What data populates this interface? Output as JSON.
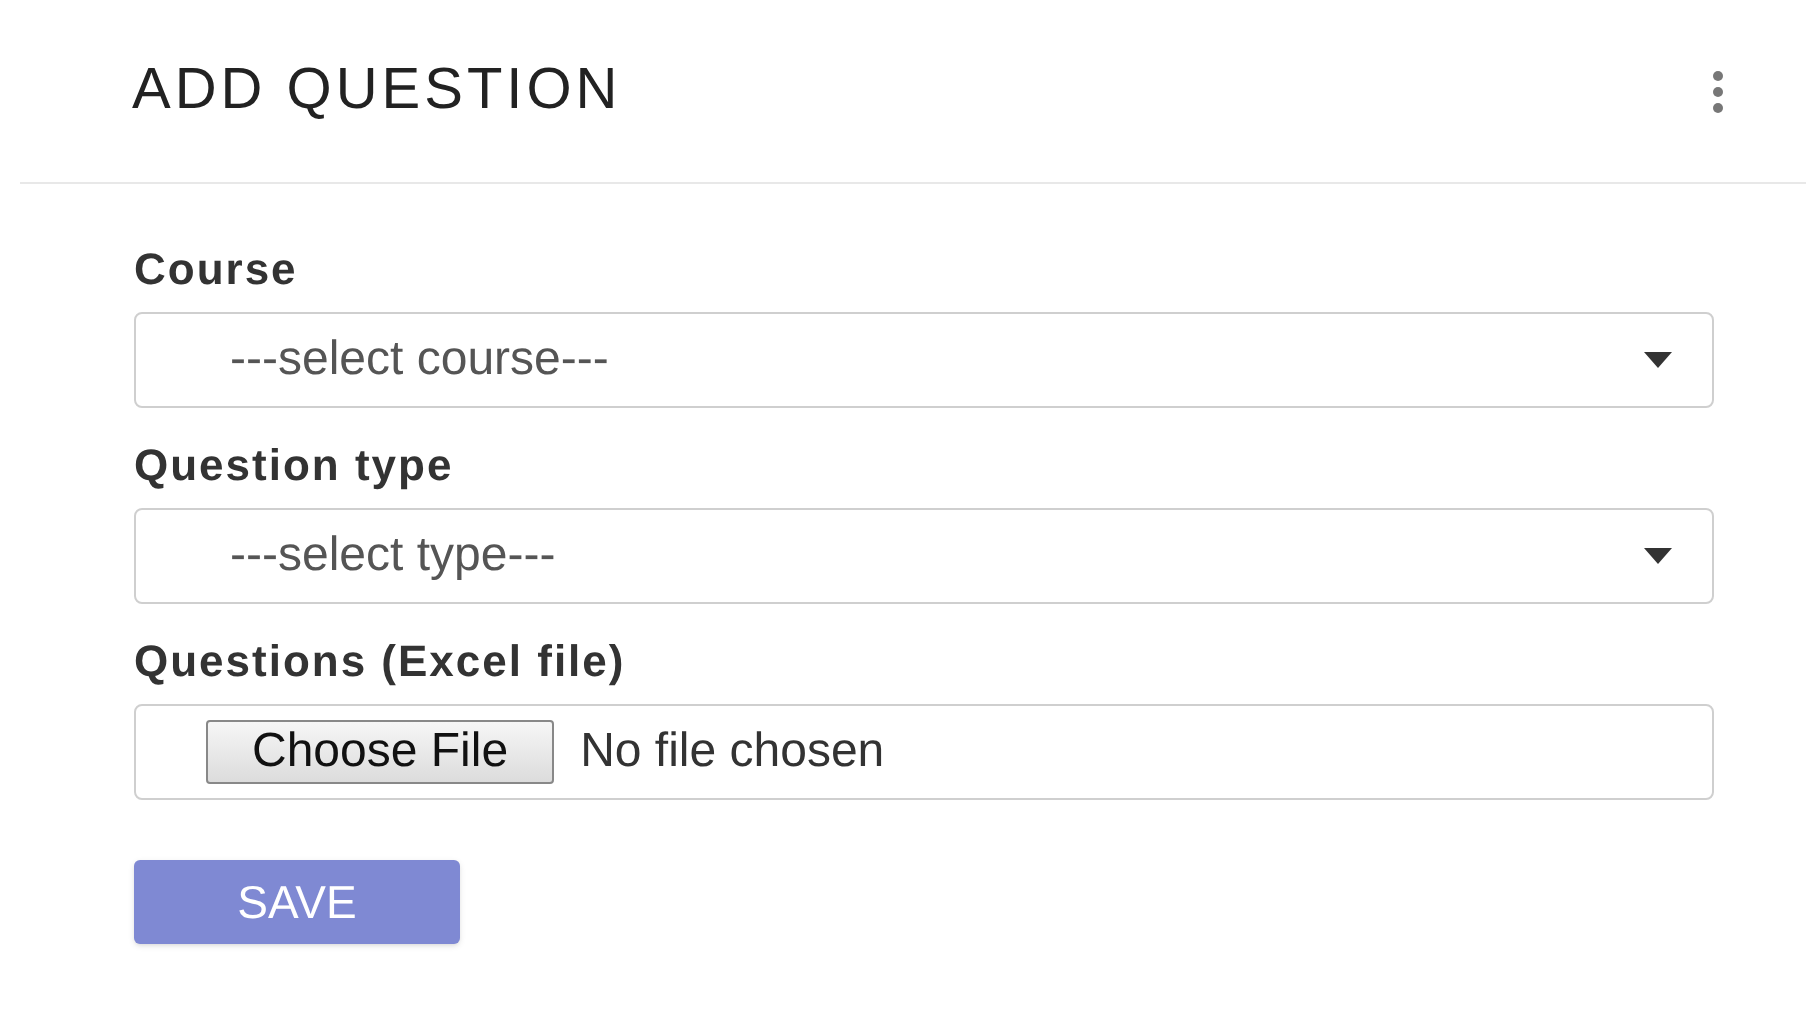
{
  "header": {
    "title": "ADD QUESTION"
  },
  "fields": [
    {
      "kind": "select",
      "label": "Course",
      "placeholder": "---select course---"
    },
    {
      "kind": "select",
      "label": "Question type",
      "placeholder": "---select type---"
    },
    {
      "kind": "file",
      "label": "Questions (Excel file)",
      "button": "Choose File",
      "status": "No file chosen"
    }
  ],
  "save_button": {
    "label": "SAVE",
    "disabled": true
  }
}
